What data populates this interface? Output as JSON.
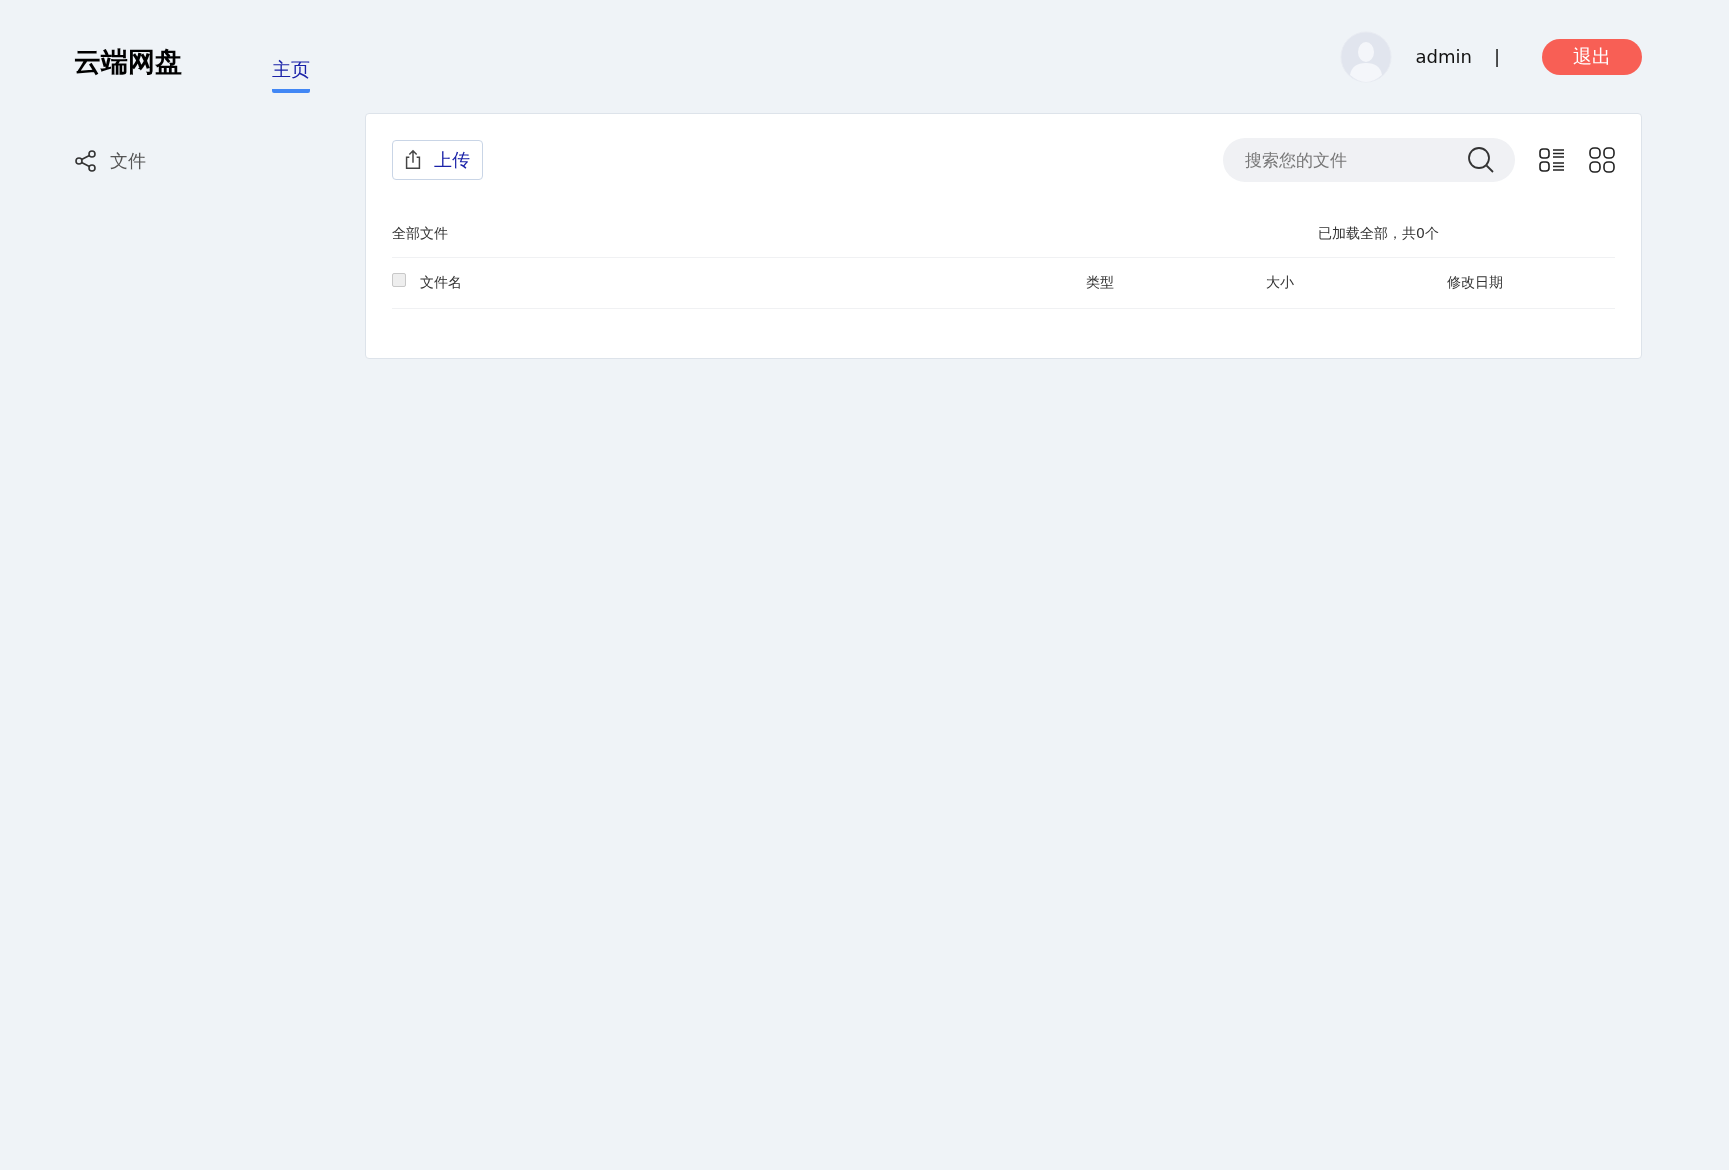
{
  "header": {
    "logo": "云端网盘",
    "nav": [
      {
        "label": "主页",
        "selected": true
      }
    ],
    "user": {
      "name": "admin",
      "separator": "|"
    },
    "logout_button": "退出"
  },
  "sidebar": {
    "items": [
      {
        "label": "文件",
        "selected": false
      }
    ]
  },
  "toolbar": {
    "upload_button": "上传",
    "search": {
      "placeholder": "搜索您的文件"
    },
    "view_modes": [
      {
        "kind": "list",
        "selected": false
      },
      {
        "kind": "grid",
        "selected": false
      }
    ]
  },
  "file_list": {
    "breadcrumb": "全部文件",
    "status": "已加载全部，共0个",
    "select_all": {
      "checked": false
    },
    "columns": [
      "文件名",
      "类型",
      "大小",
      "修改日期"
    ]
  }
}
